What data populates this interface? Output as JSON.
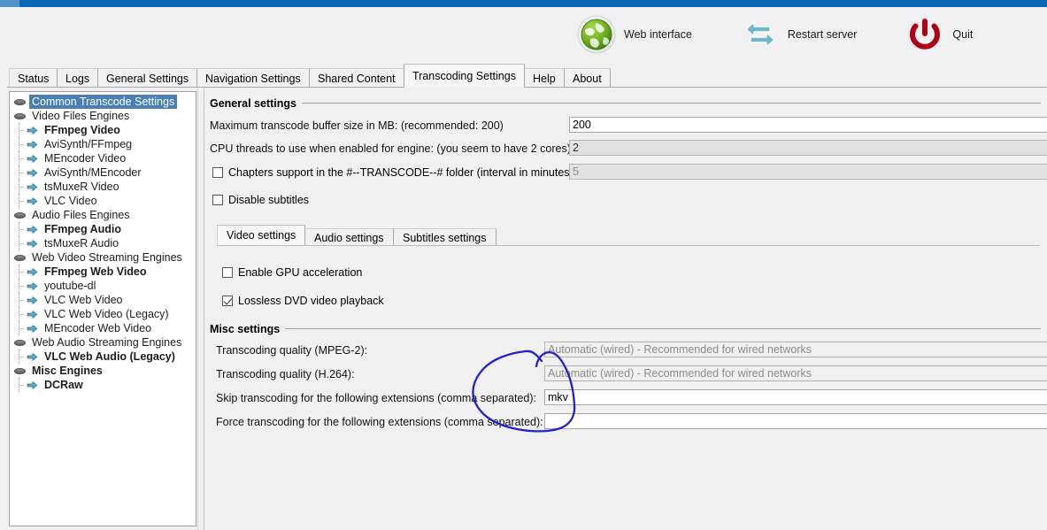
{
  "window": {
    "accent_blue": "#0a69b7"
  },
  "toolbar": {
    "buttons": [
      {
        "label": "Web interface",
        "icon": "globe-icon"
      },
      {
        "label": "Restart server",
        "icon": "restart-arrows-icon"
      },
      {
        "label": "Quit",
        "icon": "power-icon"
      }
    ]
  },
  "tabs": [
    {
      "label": "Status",
      "active": false
    },
    {
      "label": "Logs",
      "active": false
    },
    {
      "label": "General Settings",
      "active": false
    },
    {
      "label": "Navigation Settings",
      "active": false
    },
    {
      "label": "Shared Content",
      "active": false
    },
    {
      "label": "Transcoding Settings",
      "active": true
    },
    {
      "label": "Help",
      "active": false
    },
    {
      "label": "About",
      "active": false
    }
  ],
  "sidebar": {
    "items": [
      {
        "label": "Common Transcode Settings",
        "type": "folder",
        "selected": true,
        "bold": false
      },
      {
        "label": "Video Files Engines",
        "type": "folder",
        "selected": false,
        "bold": false
      },
      {
        "label": "FFmpeg Video",
        "type": "engine",
        "selected": false,
        "bold": true
      },
      {
        "label": "AviSynth/FFmpeg",
        "type": "engine",
        "selected": false,
        "bold": false
      },
      {
        "label": "MEncoder Video",
        "type": "engine",
        "selected": false,
        "bold": false
      },
      {
        "label": "AviSynth/MEncoder",
        "type": "engine",
        "selected": false,
        "bold": false
      },
      {
        "label": "tsMuxeR Video",
        "type": "engine",
        "selected": false,
        "bold": false
      },
      {
        "label": "VLC Video",
        "type": "engine",
        "selected": false,
        "bold": false
      },
      {
        "label": "Audio Files Engines",
        "type": "folder",
        "selected": false,
        "bold": false
      },
      {
        "label": "FFmpeg Audio",
        "type": "engine",
        "selected": false,
        "bold": true
      },
      {
        "label": "tsMuxeR Audio",
        "type": "engine",
        "selected": false,
        "bold": false
      },
      {
        "label": "Web Video Streaming Engines",
        "type": "folder",
        "selected": false,
        "bold": false
      },
      {
        "label": "FFmpeg Web Video",
        "type": "engine",
        "selected": false,
        "bold": true
      },
      {
        "label": "youtube-dl",
        "type": "engine",
        "selected": false,
        "bold": false
      },
      {
        "label": "VLC Web Video",
        "type": "engine",
        "selected": false,
        "bold": false
      },
      {
        "label": "VLC Web Video (Legacy)",
        "type": "engine",
        "selected": false,
        "bold": false
      },
      {
        "label": "MEncoder Web Video",
        "type": "engine",
        "selected": false,
        "bold": false
      },
      {
        "label": "Web Audio Streaming Engines",
        "type": "folder",
        "selected": false,
        "bold": false
      },
      {
        "label": "VLC Web Audio (Legacy)",
        "type": "engine",
        "selected": false,
        "bold": true
      },
      {
        "label": "Misc Engines",
        "type": "folder",
        "selected": false,
        "bold": true
      },
      {
        "label": "DCRaw",
        "type": "engine",
        "selected": false,
        "bold": true
      }
    ]
  },
  "general": {
    "title": "General settings",
    "buffer_label": "Maximum transcode buffer size in MB: (recommended: 200)",
    "buffer_value": "200",
    "cpu_label": "CPU threads to use when enabled for engine: (you seem to have 2 cores)",
    "cpu_value": "2",
    "chapters_label": "Chapters support in the #--TRANSCODE--# folder (interval in minutes):",
    "chapters_checked": false,
    "chapters_value": "5",
    "disable_subtitles_label": "Disable subtitles",
    "disable_subtitles_checked": false
  },
  "subtabs": [
    {
      "label": "Video settings",
      "active": true
    },
    {
      "label": "Audio settings",
      "active": false
    },
    {
      "label": "Subtitles settings",
      "active": false
    }
  ],
  "video": {
    "gpu_label": "Enable GPU acceleration",
    "gpu_checked": false,
    "lossless_label": "Lossless DVD video playback",
    "lossless_checked": true
  },
  "misc": {
    "title": "Misc settings",
    "mpeg2_label": "Transcoding quality (MPEG-2):",
    "mpeg2_value": "Automatic (wired) - Recommended for wired networks",
    "h264_label": "Transcoding quality (H.264):",
    "h264_value": "Automatic (wired) - Recommended for wired networks",
    "skip_label": "Skip transcoding for the following extensions (comma separated):",
    "skip_value": "mkv",
    "force_label": "Force transcoding for the following extensions (comma separated):",
    "force_value": ""
  },
  "annotation": {
    "color": "#2222cc",
    "shape": "hand-drawn-circle"
  }
}
